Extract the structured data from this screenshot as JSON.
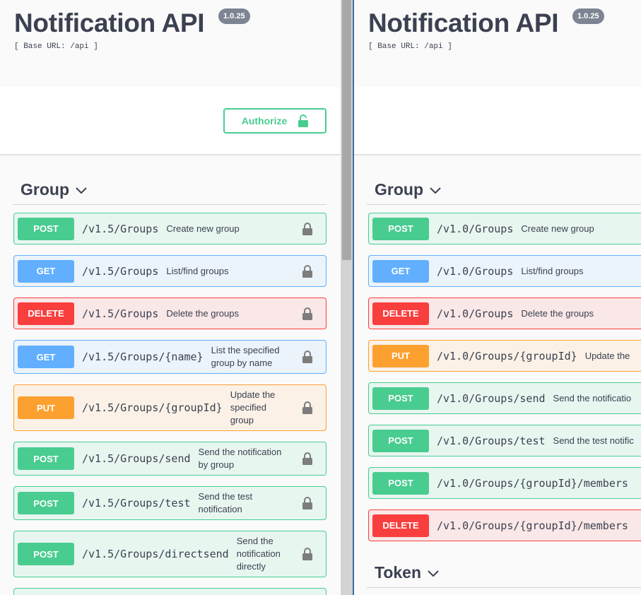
{
  "left": {
    "title": "Notification API",
    "version": "1.0.25",
    "base_url": "[ Base URL: /api ]",
    "authorize_label": "Authorize",
    "tag": "Group",
    "operations": [
      {
        "method": "POST",
        "path": "/v1.5/Groups",
        "summary": "Create new group"
      },
      {
        "method": "GET",
        "path": "/v1.5/Groups",
        "summary": "List/find groups"
      },
      {
        "method": "DELETE",
        "path": "/v1.5/Groups",
        "summary": "Delete the groups"
      },
      {
        "method": "GET",
        "path": "/v1.5/Groups/{name}",
        "summary": "List the specified group by name"
      },
      {
        "method": "PUT",
        "path": "/v1.5/Groups/{groupId}",
        "summary": "Update the specified group"
      },
      {
        "method": "POST",
        "path": "/v1.5/Groups/send",
        "summary": "Send the notification by group"
      },
      {
        "method": "POST",
        "path": "/v1.5/Groups/test",
        "summary": "Send the test notification"
      },
      {
        "method": "POST",
        "path": "/v1.5/Groups/directsend",
        "summary": "Send the notification directly"
      }
    ]
  },
  "right": {
    "title": "Notification API",
    "version": "1.0.25",
    "base_url": "[ Base URL: /api ]",
    "tag": "Group",
    "tag2": "Token",
    "operations": [
      {
        "method": "POST",
        "path": "/v1.0/Groups",
        "summary": "Create new group"
      },
      {
        "method": "GET",
        "path": "/v1.0/Groups",
        "summary": "List/find groups"
      },
      {
        "method": "DELETE",
        "path": "/v1.0/Groups",
        "summary": "Delete the groups"
      },
      {
        "method": "PUT",
        "path": "/v1.0/Groups/{groupId}",
        "summary": "Update the"
      },
      {
        "method": "POST",
        "path": "/v1.0/Groups/send",
        "summary": "Send the notificatio"
      },
      {
        "method": "POST",
        "path": "/v1.0/Groups/test",
        "summary": "Send the test notific"
      },
      {
        "method": "POST",
        "path": "/v1.0/Groups/{groupId}/members",
        "summary": ""
      },
      {
        "method": "DELETE",
        "path": "/v1.0/Groups/{groupId}/members",
        "summary": ""
      }
    ]
  },
  "colors": {
    "post": "#49cc90",
    "get": "#61affe",
    "delete": "#f93e3e",
    "put": "#fca130",
    "badge": "#7d8492",
    "text": "#3b4151"
  },
  "icons": {
    "lock": "lock-icon",
    "unlock": "unlock-icon",
    "chevron": "chevron-down-icon"
  }
}
